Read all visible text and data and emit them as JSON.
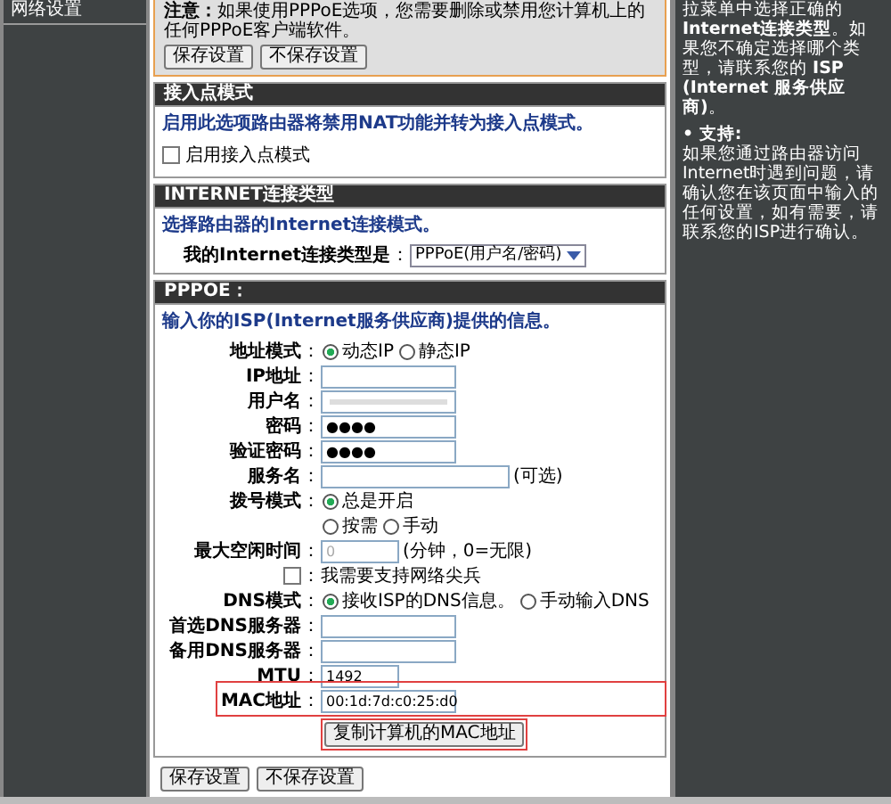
{
  "sidebar": {
    "items": [
      {
        "label": "网络设置",
        "selected": false
      }
    ]
  },
  "notice": {
    "text": "**注意：**如果使用PPPoE选项，您需要删除或禁用您计算机上的任何PPPoE客户端软件。",
    "buttons": [
      "保存设置",
      "不保存设置"
    ]
  },
  "ap_mode": {
    "title": "接入点模式",
    "description": "启用此选项路由器将禁用NAT功能并转为接入点模式。",
    "checkbox": {
      "label": "启用接入点模式",
      "checked": false
    }
  },
  "internet": {
    "title": "INTERNET连接类型",
    "description": "选择路由器的Internet连接模式。",
    "label": "我的Internet连接类型是",
    "colon": "：",
    "select": "PPPoE(用户名/密码)"
  },
  "pppoe": {
    "title": "PPPOE：",
    "description": "输入你的ISP(Internet服务供应商)提供的信息。",
    "rows": [
      {
        "kind": "radio",
        "label": "地址模式",
        "colon": "：",
        "options": [
          {
            "label": "动态IP",
            "selected": true
          },
          {
            "label": "静态IP",
            "selected": false
          }
        ]
      },
      {
        "kind": "input",
        "label": "IP地址",
        "colon": "：",
        "value": ""
      },
      {
        "kind": "blurred",
        "label": "用户名",
        "colon": "："
      },
      {
        "kind": "input",
        "label": "密码",
        "colon": "：",
        "value": "●●●●"
      },
      {
        "kind": "input",
        "label": "验证密码",
        "colon": "：",
        "value": "●●●●"
      },
      {
        "kind": "wide_input",
        "label": "服务名",
        "colon": "：",
        "value": "",
        "suffix": "(可选)"
      },
      {
        "kind": "radio",
        "label": "拨号模式",
        "colon": "：",
        "options": [
          {
            "label": "总是开启",
            "selected": true
          }
        ]
      },
      {
        "kind": "radio",
        "label": "",
        "options": [
          {
            "label": "按需",
            "selected": false
          },
          {
            "label": "手动",
            "selected": false
          }
        ]
      },
      {
        "kind": "short_input",
        "label": "最大空闲时间",
        "colon": "：",
        "value": "0",
        "disabled": true,
        "suffix": "(分钟，0=无限)"
      },
      {
        "kind": "checkbox",
        "checked": false,
        "colon": "：",
        "text": "我需要支持网络尖兵"
      },
      {
        "kind": "radio",
        "label": "DNS模式",
        "colon": "：",
        "options": [
          {
            "label": "接收ISP的DNS信息。",
            "selected": true
          },
          {
            "label": "手动输入DNS",
            "selected": false
          }
        ]
      },
      {
        "kind": "input",
        "label": "首选DNS服务器",
        "colon": "：",
        "value": ""
      },
      {
        "kind": "input",
        "label": "备用DNS服务器",
        "colon": "：",
        "value": ""
      },
      {
        "kind": "short_input",
        "label": "MTU",
        "colon": "：",
        "value": "1492"
      },
      {
        "kind": "input",
        "label": "MAC地址",
        "colon": "：",
        "value": "00:1d:7d:c0:25:d0",
        "highlighted": true
      },
      {
        "kind": "button",
        "label": "复制计算机的MAC地址",
        "highlighted": true
      }
    ]
  },
  "buttons": [
    "保存设置",
    "不保存设置"
  ],
  "help": {
    "paragraphs": [
      {
        "kind": "text",
        "text": "拉菜单中选择正确的 **Internet连接类型**。如果您不确定选择哪个类型，请联系您的 **ISP (Internet 服务供应商)**。"
      },
      {
        "kind": "heading",
        "text": "• 支持:"
      },
      {
        "kind": "text",
        "text": "如果您通过路由器访问Internet时遇到问题，请确认您在该页面中输入的任何设置，如有需要，请联系您的ISP进行确认。"
      }
    ]
  }
}
